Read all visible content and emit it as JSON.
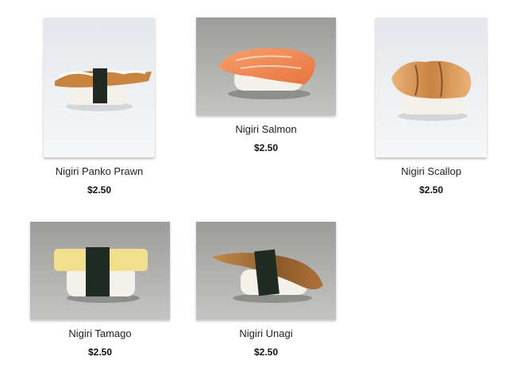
{
  "products": [
    {
      "name": "Nigiri Panko Prawn",
      "price": "$2.50",
      "image": "nigiri-panko-prawn-photo"
    },
    {
      "name": "Nigiri Salmon",
      "price": "$2.50",
      "image": "nigiri-salmon-photo"
    },
    {
      "name": "Nigiri Scallop",
      "price": "$2.50",
      "image": "nigiri-scallop-photo"
    },
    {
      "name": "Nigiri Tamago",
      "price": "$2.50",
      "image": "nigiri-tamago-photo"
    },
    {
      "name": "Nigiri Unagi",
      "price": "$2.50",
      "image": "nigiri-unagi-photo"
    }
  ],
  "colors": {
    "background": "#ffffff",
    "photo_bg_light": "#eceef2",
    "photo_bg_grey": "#a9aaa8",
    "rice": "#f4f2ec",
    "nori": "#1f2a22",
    "salmon": "#f08a55",
    "tamago": "#f1df8e",
    "unagi": "#8a5a2a",
    "scallop": "#d99a58",
    "prawn": "#c8843e"
  }
}
